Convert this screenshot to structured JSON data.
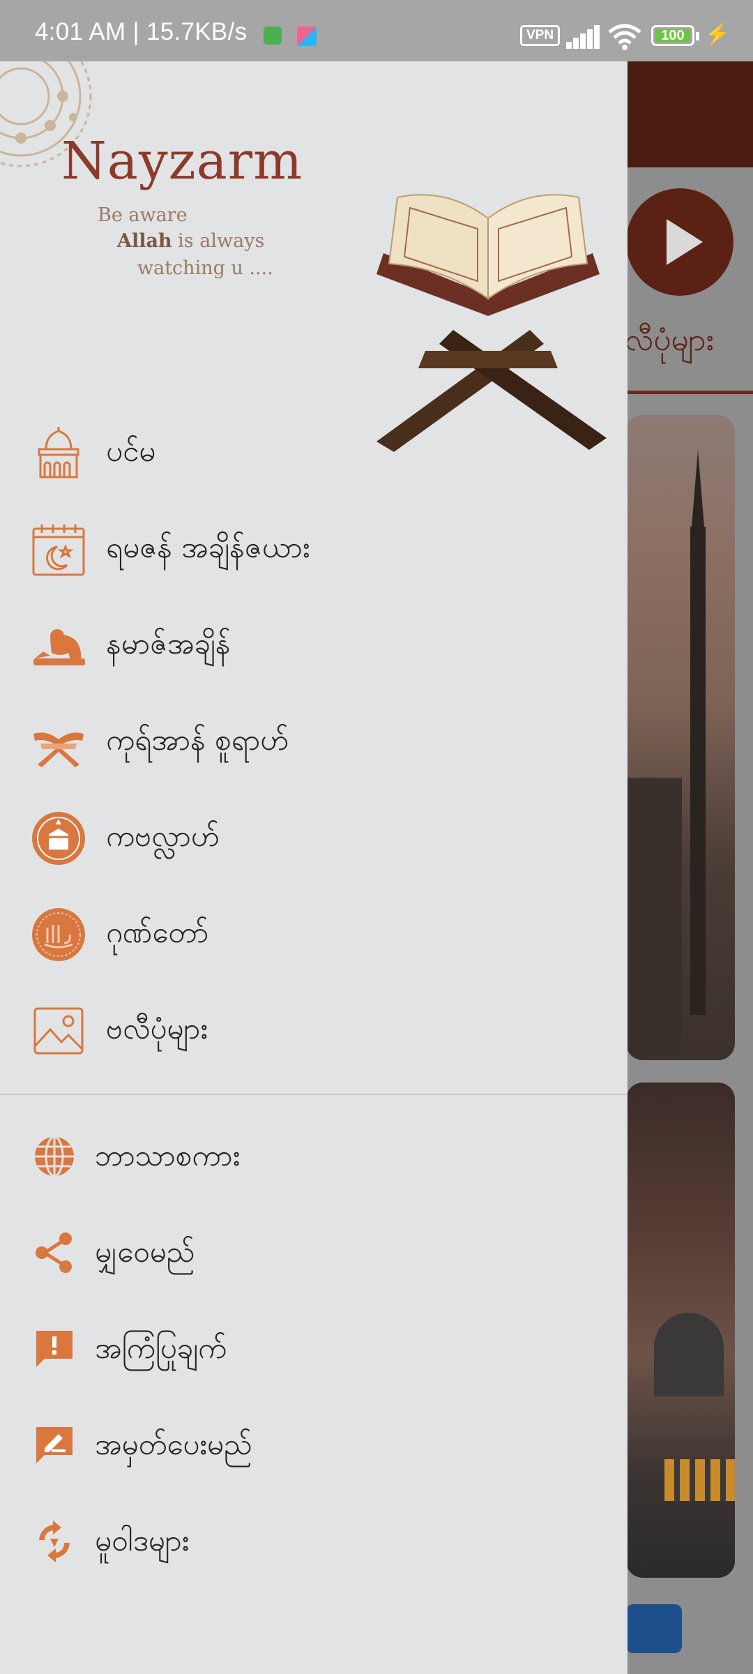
{
  "status_bar": {
    "time_speed": "4:01 AM | 15.7KB/s",
    "vpn_label": "VPN",
    "battery_level": "100"
  },
  "drawer": {
    "brand_name": "Nayzarm",
    "tagline_line1": "Be aware",
    "tagline_allah": "Allah",
    "tagline_line2_rest": " is always",
    "tagline_line3": "watching u ....",
    "primary_items": [
      {
        "label": "ပင်မ",
        "icon": "mosque-icon"
      },
      {
        "label": "ရမဇန် အချိန်ဇယား",
        "icon": "ramadan-calendar-icon"
      },
      {
        "label": "နမာဇ်အချိန်",
        "icon": "prayer-person-icon"
      },
      {
        "label": "ကုရ်အာန် စူရာဟ်",
        "icon": "open-quran-icon"
      },
      {
        "label": "ကဗလ္လာဟ်",
        "icon": "kaaba-compass-icon"
      },
      {
        "label": "ဂုဏ်တော်",
        "icon": "allah-calligraphy-icon"
      },
      {
        "label": "ဗလီပုံများ",
        "icon": "image-icon"
      }
    ],
    "secondary_items": [
      {
        "label": "ဘာသာစကား",
        "icon": "globe-icon"
      },
      {
        "label": "မျှဝေမည်",
        "icon": "share-icon"
      },
      {
        "label": "အကြံပြုချက်",
        "icon": "feedback-icon"
      },
      {
        "label": "အမှတ်ပေးမည်",
        "icon": "rate-icon"
      },
      {
        "label": "မူဝါဒများ",
        "icon": "policy-refresh-icon"
      }
    ],
    "accent_color": "#d9773f"
  },
  "background_screen": {
    "section_label": "လီပုံများ"
  }
}
